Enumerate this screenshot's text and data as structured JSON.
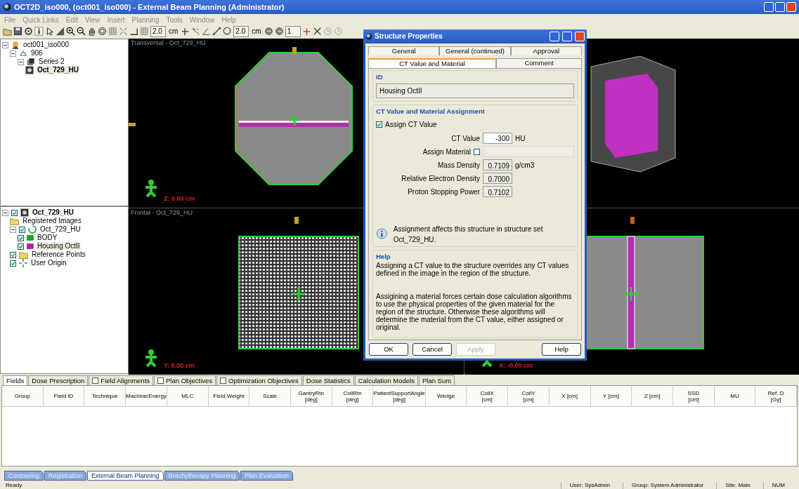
{
  "window": {
    "title": "OCT2D_iso000,  (oct001_iso000) - External Beam Planning (Administrator)"
  },
  "menu": [
    "File",
    "Quick Links",
    "Edit",
    "View",
    "Insert",
    "Planning",
    "Tools",
    "Window",
    "Help"
  ],
  "toolbar": {
    "fields": [
      {
        "value": "2.0",
        "unit": "cm"
      },
      {
        "value": "2.0",
        "unit": "cm"
      },
      {
        "value": "1"
      }
    ]
  },
  "patient_tree": [
    {
      "label": "oct001_iso000",
      "kind": "patient",
      "children": [
        {
          "label": "906",
          "kind": "study",
          "children": [
            {
              "label": "Series 2",
              "kind": "series",
              "children": [
                {
                  "label": "Oct_729_HU",
                  "kind": "image",
                  "selected": true
                }
              ]
            }
          ]
        }
      ]
    }
  ],
  "structure_tree": [
    {
      "label": "Oct_729_HU",
      "kind": "image",
      "checked": true,
      "children": [
        {
          "label": "Registered Images",
          "kind": "folder"
        },
        {
          "label": "Oct_729_HU",
          "kind": "structure_set",
          "checked": true,
          "children": [
            {
              "label": "BODY",
              "kind": "structure",
              "checked": true,
              "color": "#22a022",
              "selected": false
            },
            {
              "label": "Housing OctII",
              "kind": "structure",
              "checked": true,
              "color": "#b02aa8",
              "selected": true
            }
          ]
        },
        {
          "label": "Reference Points",
          "kind": "folder",
          "checked": true
        },
        {
          "label": "User Origin",
          "kind": "origin",
          "checked": true
        }
      ]
    }
  ],
  "views": [
    {
      "kind": "transversal",
      "title": "Transversal - Oct_729_HU",
      "coordinate": "Z: 0.00 cm"
    },
    {
      "kind": "model"
    },
    {
      "kind": "frontal",
      "title": "Frontal - Oct_729_HU",
      "coordinate": "Y: 0.00 cm"
    },
    {
      "kind": "sagittal",
      "coordinate": "X: -0.00 cm"
    }
  ],
  "dialog": {
    "title": "Structure Properties",
    "tab_rows": [
      [
        {
          "label": "General",
          "selected": false
        },
        {
          "label": "General (continued)",
          "selected": false
        },
        {
          "label": "Approval",
          "selected": false
        }
      ],
      [
        {
          "label": "CT Value and Material",
          "selected": true
        },
        {
          "label": "Comment",
          "selected": false
        }
      ]
    ],
    "id_section": {
      "legend": "ID",
      "value": "Housing OctII"
    },
    "assignment": {
      "legend": "CT Value and Material Assignment",
      "assign_ct": {
        "label": "Assign CT Value",
        "checked": true
      },
      "rows": [
        {
          "kind": "input",
          "label": "CT Value",
          "value": "-300",
          "unit": "HU"
        },
        {
          "kind": "select",
          "label": "Assign Material",
          "checked": false
        },
        {
          "kind": "readonly",
          "label": "Mass Density",
          "value": "0.7109",
          "unit": "g/cm3"
        },
        {
          "kind": "readonly",
          "label": "Relative Electron Density",
          "value": "0.7000"
        },
        {
          "kind": "readonly",
          "label": "Proton Stopping Power",
          "value": "0.7102"
        }
      ],
      "note": "Assignment affects this structure in structure set Oct_729_HU."
    },
    "help": {
      "legend": "Help",
      "paragraphs": [
        "Assigning a CT value to the structure overrides any CT values defined in the image in the region of the structure.",
        "Assigining a material forces certain dose calculation algorithms to use the physical properties of the given material for the region of the structure. Otherwise these algorithms will determine the material from the CT value, either assigned or original."
      ]
    },
    "buttons": [
      {
        "label": "OK",
        "disabled": false
      },
      {
        "label": "Cancel",
        "disabled": false
      },
      {
        "label": "Apply",
        "disabled": true
      },
      {
        "label": "Help",
        "disabled": false
      }
    ]
  },
  "plan_tabs": [
    {
      "label": "Fields",
      "selected": true
    },
    {
      "label": "Dose Prescription",
      "selected": false
    },
    {
      "label": "Field Alignments",
      "selected": false,
      "checked": false
    },
    {
      "label": "Plan Objectives",
      "selected": false,
      "checked": false
    },
    {
      "label": "Optimization Objectives",
      "selected": false,
      "checked": false
    },
    {
      "label": "Dose Statistics",
      "selected": false
    },
    {
      "label": "Calculation Models",
      "selected": false
    },
    {
      "label": "Plan Sum",
      "selected": false
    }
  ],
  "table": {
    "columns": [
      "Group",
      "Field ID",
      "Technique",
      "Machine/Energy",
      "MLC",
      "Field Weight",
      "Scale",
      "GantryRtn\n[deg]",
      "CollRtn\n[deg]",
      "PatientSupportAngle\n[deg]",
      "Wedge",
      "CollX\n[cm]",
      "CollY\n[cm]",
      "X [cm]",
      "Y [cm]",
      "Z [cm]",
      "SSD\n[cm]",
      "MU",
      "Ref. D\n[Gy]"
    ]
  },
  "module_tabs": [
    {
      "label": "Contouring",
      "selected": false
    },
    {
      "label": "Registration",
      "selected": false
    },
    {
      "label": "External Beam Planning",
      "selected": true
    },
    {
      "label": "Brachytherapy Planning",
      "selected": false
    },
    {
      "label": "Plan Evaluation",
      "selected": false
    }
  ],
  "status_bar": [
    "Ready",
    "User: SysAdmin",
    "Group: System Administrator",
    "Site: Main",
    "NUM"
  ]
}
